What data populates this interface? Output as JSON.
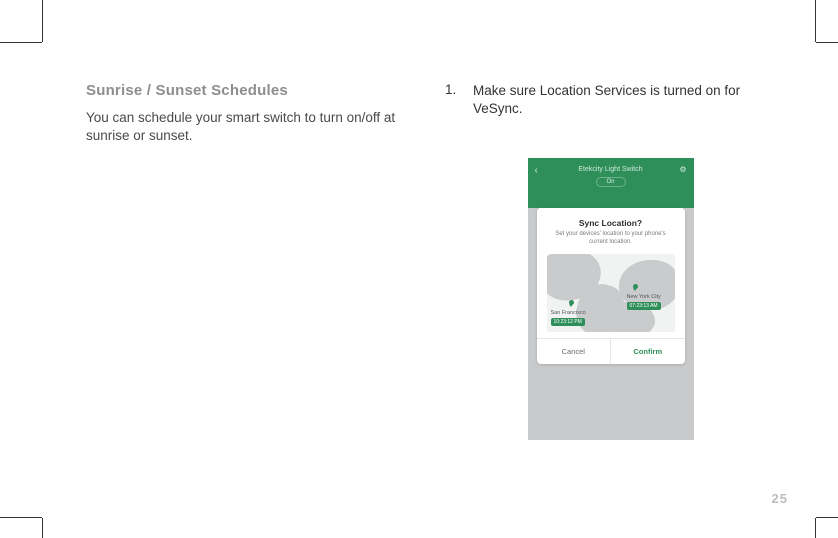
{
  "left": {
    "heading": "Sunrise / Sunset Schedules",
    "body": "You can schedule your smart switch to turn on/off at sunrise or sunset."
  },
  "right": {
    "step_number": "1.",
    "step_text": "Make sure Location Services is turned on for VeSync."
  },
  "phone": {
    "title": "Etekcity Light Switch",
    "status": "On",
    "dialog": {
      "title": "Sync Location?",
      "subtitle": "Set your devices' location to your phone's current location.",
      "sf": {
        "name": "San Francisco",
        "time": "10:23:12 PM"
      },
      "ny": {
        "name": "New York City",
        "time": "07:23:13 AM"
      },
      "cancel": "Cancel",
      "confirm": "Confirm"
    }
  },
  "page_number": "25"
}
